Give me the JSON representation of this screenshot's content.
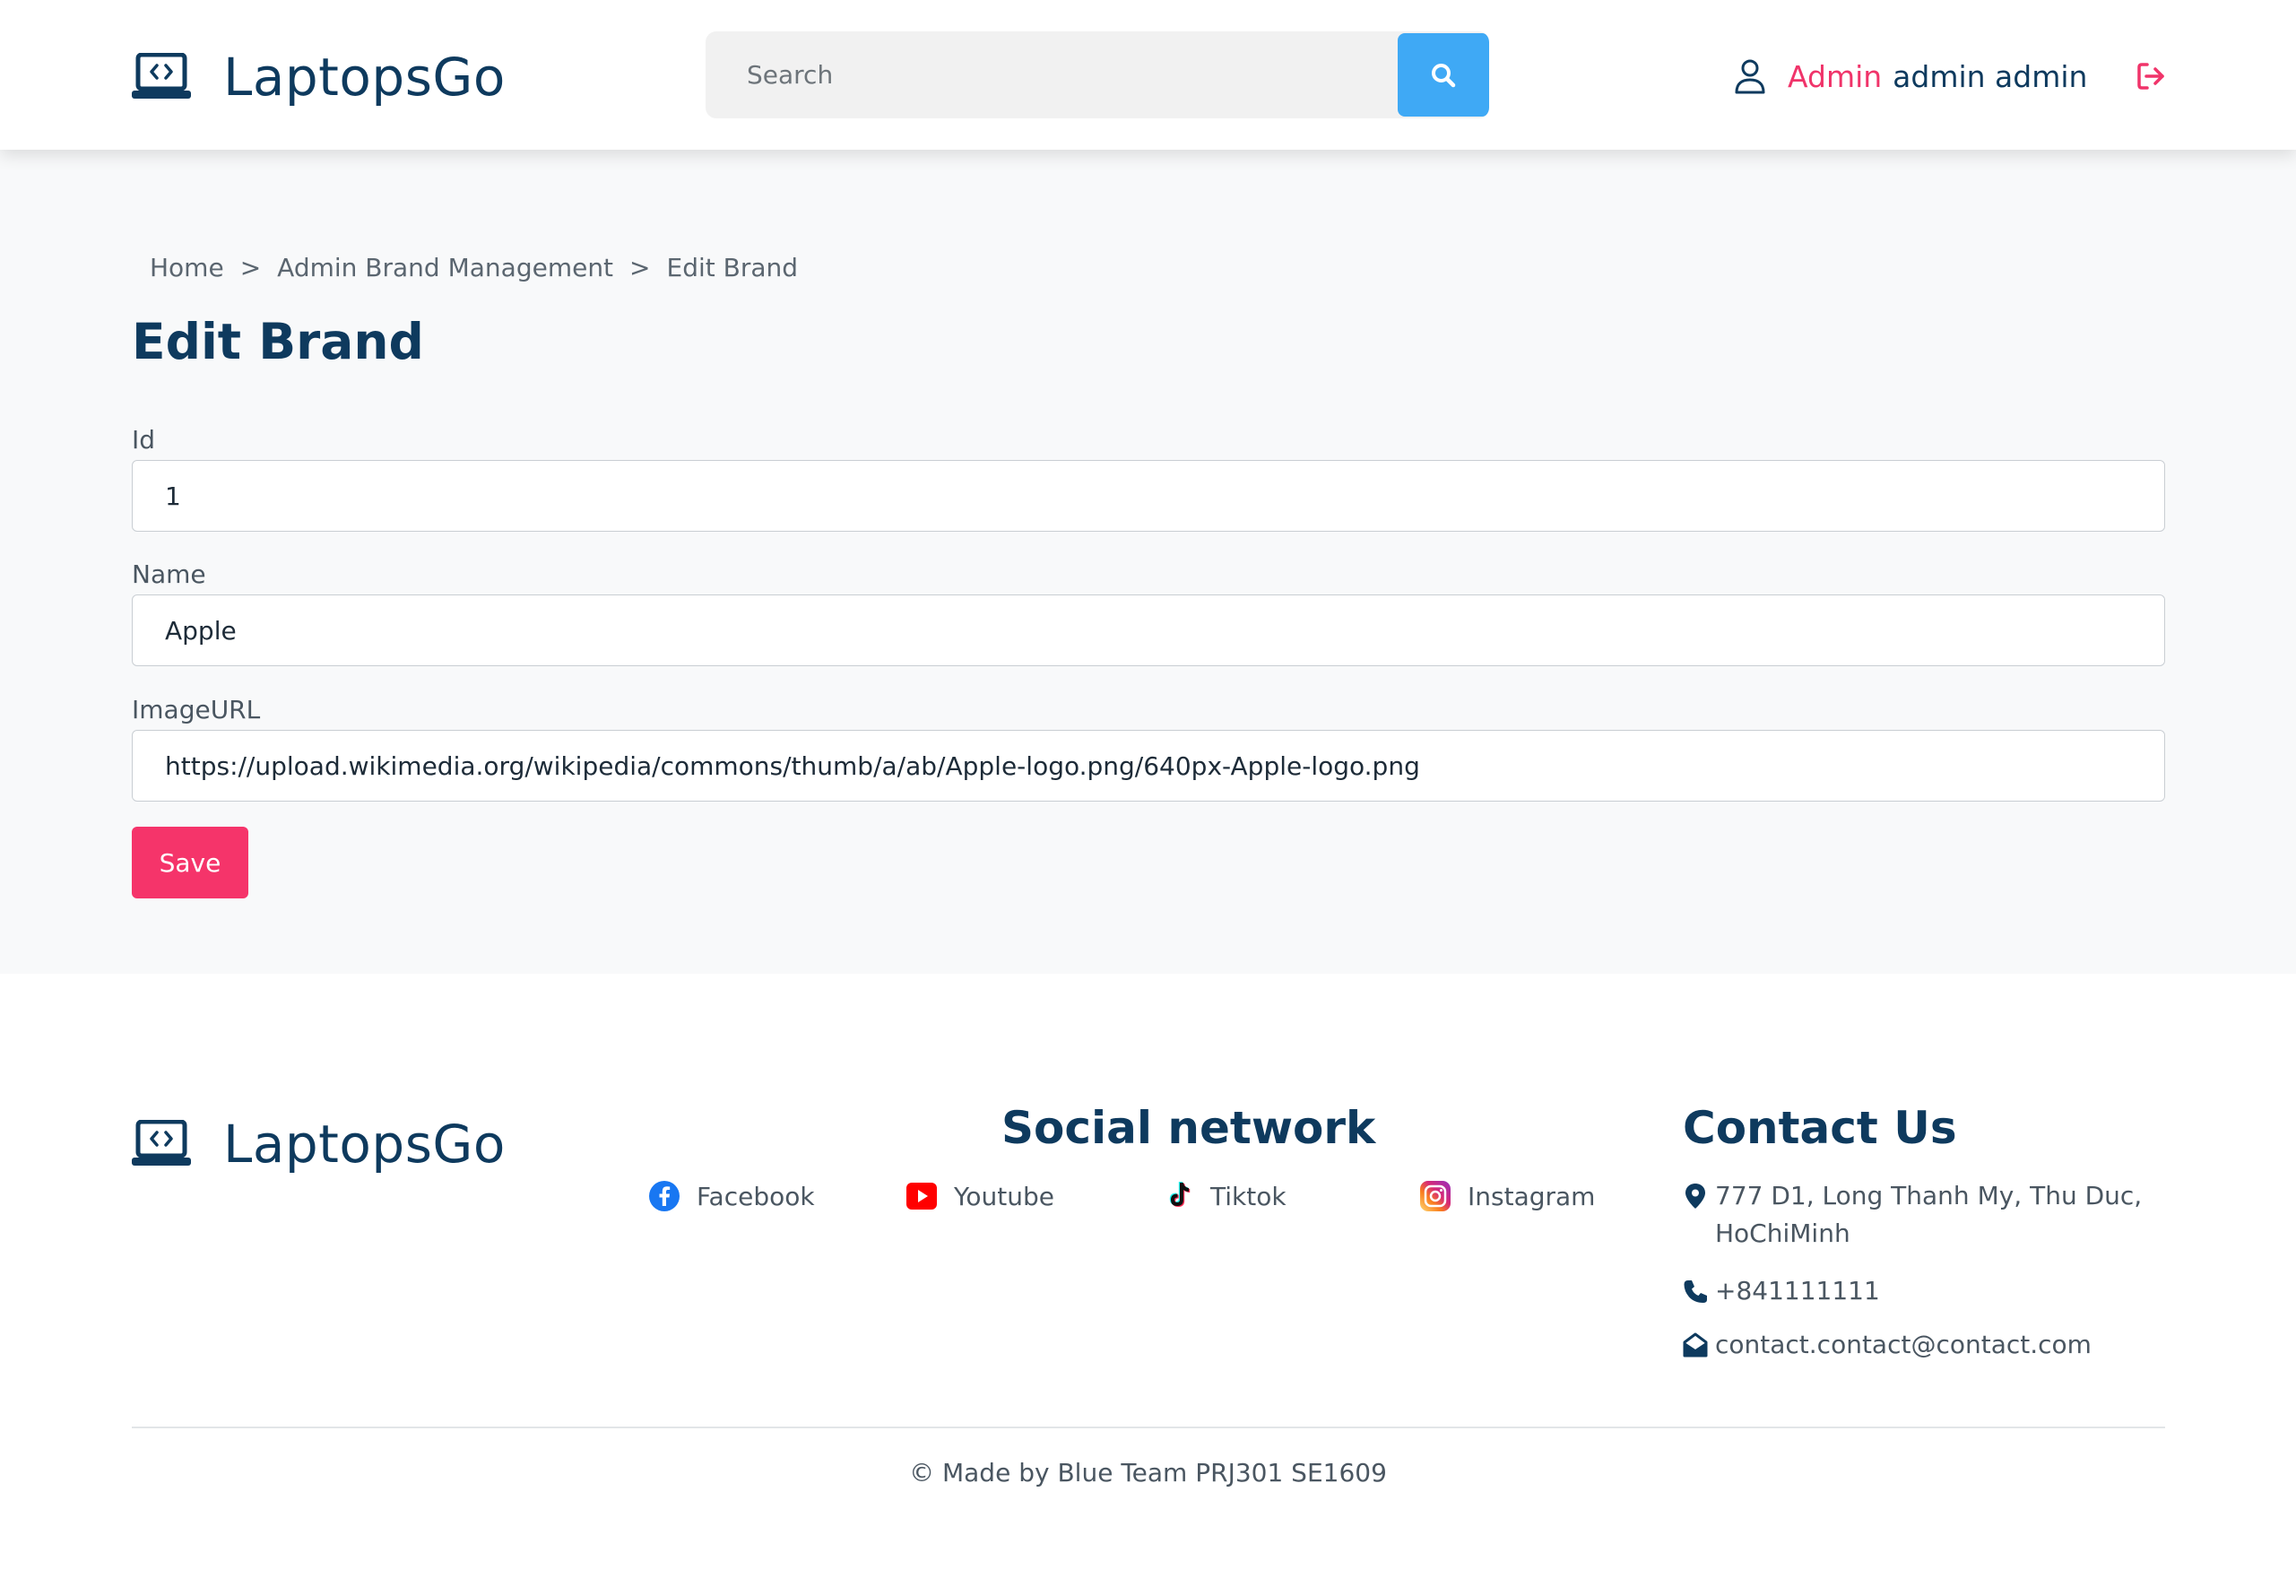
{
  "brand": {
    "name": "LaptopsGo"
  },
  "header": {
    "search_placeholder": "Search",
    "user_role": "Admin",
    "user_name": "admin admin",
    "icons": {
      "search": "search-icon",
      "user": "user-icon",
      "logout": "logout-icon"
    }
  },
  "breadcrumb": {
    "items": [
      "Home",
      "Admin Brand Management",
      "Edit Brand"
    ],
    "separator": ">"
  },
  "form": {
    "title": "Edit Brand",
    "fields": [
      {
        "label": "Id",
        "value": "1"
      },
      {
        "label": "Name",
        "value": "Apple"
      },
      {
        "label": "ImageURL",
        "value": "https://upload.wikimedia.org/wikipedia/commons/thumb/a/ab/Apple-logo.png/640px-Apple-logo.png"
      }
    ],
    "save_label": "Save"
  },
  "footer": {
    "social_title": "Social network",
    "social": [
      {
        "label": "Facebook",
        "icon": "facebook-icon"
      },
      {
        "label": "Youtube",
        "icon": "youtube-icon"
      },
      {
        "label": "Tiktok",
        "icon": "tiktok-icon"
      },
      {
        "label": "Instagram",
        "icon": "instagram-icon"
      }
    ],
    "contact_title": "Contact Us",
    "address_line1": "777 D1, Long Thanh My, Thu Duc,",
    "address_line2": "HoChiMinh",
    "phone": "+841111111",
    "email": "contact.contact@contact.com",
    "copyright": "© Made by Blue Team PRJ301 SE1609"
  },
  "colors": {
    "primary": "#0e3a5e",
    "accent": "#f5346a",
    "search_button": "#3fa9f5",
    "main_background": "#f8f9fa"
  }
}
